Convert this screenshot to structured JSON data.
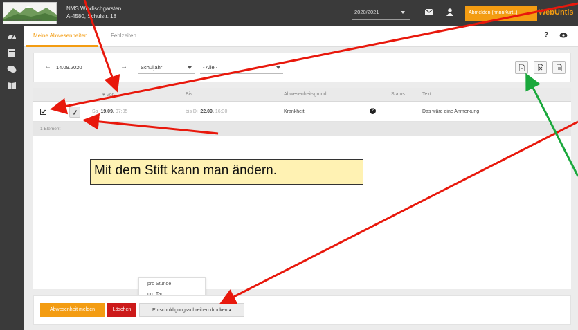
{
  "school": {
    "name": "NMS Windischgarsten",
    "address": "A-4580, Schulstr. 18",
    "logo_text": "NMS WINDISCHGARSTEN"
  },
  "header": {
    "school_year": "2020/2021",
    "logout_label": "Abmelden (nnnnKurt..)",
    "brand": "WebUntis",
    "icons": [
      "envelope-icon",
      "user-icon"
    ]
  },
  "sidebar": {
    "items": [
      "dashboard-icon",
      "calendar-icon",
      "chat-icon",
      "book-icon"
    ]
  },
  "tabs": [
    {
      "label": "Meine Abwesenheiten",
      "active": true
    },
    {
      "label": "Fehlzeiten",
      "active": false
    }
  ],
  "toolbar": {
    "help_label": "?",
    "eye_icon": "eye-icon"
  },
  "filters": {
    "date": "14.09.2020",
    "period": "Schuljahr",
    "reason": "- Alle -",
    "export_icons": [
      "pdf-icon",
      "excel-icon",
      "file-icon"
    ]
  },
  "table": {
    "columns": [
      "Von",
      "Bis",
      "Abwesenheitsgrund",
      "Status",
      "Text"
    ],
    "rows": [
      {
        "from_weekday": "Sa",
        "from_date": "19.09.",
        "from_time": "07:05",
        "to_prefix": "bis Di",
        "to_date": "22.09.",
        "to_time": "16:30",
        "reason": "Krankheit",
        "status_icon": "question-circle-icon",
        "text": "Das wäre eine Anmerkung"
      }
    ],
    "footer": "1 Element"
  },
  "print_menu": {
    "options": [
      "pro Stunde",
      "pro Tag"
    ]
  },
  "actions": {
    "report": "Abwesenheit melden",
    "delete": "Löschen",
    "print": "Entschuldigungsschreiben drucken ▴"
  },
  "annotation": {
    "text": "Mit dem Stift kann man ändern.",
    "arrow_colors": [
      "#e8180c",
      "#1aa83c"
    ]
  },
  "colors": {
    "accent": "#f39c12",
    "danger": "#cc1a1a",
    "dark": "#3a3a3a"
  }
}
